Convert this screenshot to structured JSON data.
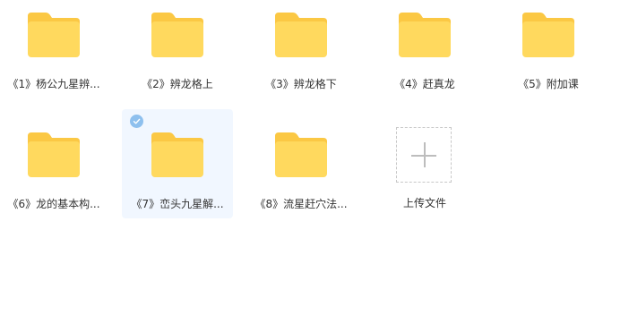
{
  "folders": [
    {
      "label": "《1》杨公九星辨..."
    },
    {
      "label": "《2》辨龙格上"
    },
    {
      "label": "《3》辨龙格下"
    },
    {
      "label": "《4》赶真龙"
    },
    {
      "label": "《5》附加课"
    },
    {
      "label": "《6》龙的基本构..."
    },
    {
      "label": "《7》峦头九星解..."
    },
    {
      "label": "《8》流星赶穴法..."
    }
  ],
  "upload": {
    "label": "上传文件"
  },
  "colors": {
    "folder_body": "#ffd95e",
    "folder_tab": "#fbc844",
    "selected_bg": "#f1f7ff",
    "check": "#8ec0ee"
  },
  "icons": {
    "folder": "folder-icon",
    "check": "check-icon",
    "upload": "plus-icon"
  }
}
